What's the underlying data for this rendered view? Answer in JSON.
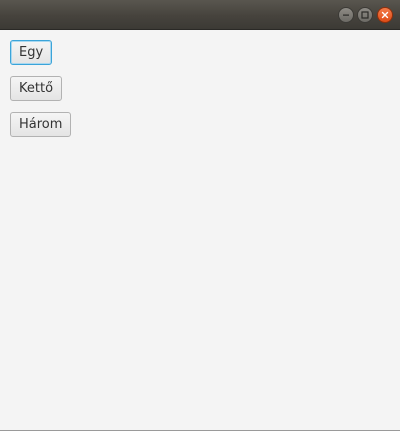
{
  "window": {
    "title": "",
    "controls": {
      "minimize_icon": "minimize-icon",
      "maximize_icon": "maximize-icon",
      "close_icon": "close-icon"
    },
    "colors": {
      "titlebar": "#46433d",
      "close_accent": "#e95420",
      "content_bg": "#f4f4f4",
      "focus_ring": "#3ba4d9"
    }
  },
  "buttons": [
    {
      "label": "Egy",
      "focused": true
    },
    {
      "label": "Kettő",
      "focused": false
    },
    {
      "label": "Három",
      "focused": false
    }
  ]
}
